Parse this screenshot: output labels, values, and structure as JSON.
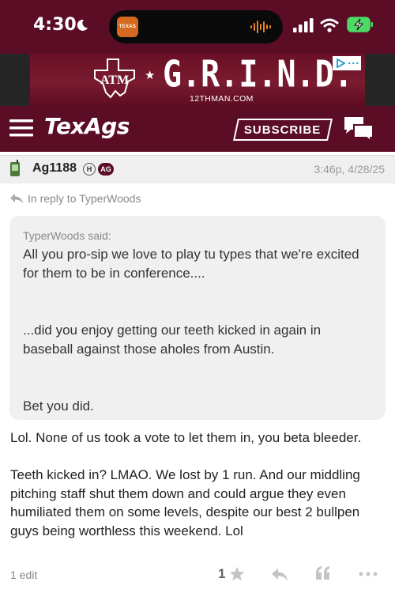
{
  "status_bar": {
    "time": "4:30",
    "island_app_label": "TEXAS"
  },
  "ad": {
    "logo_letters": "ATM",
    "title": "G.R.I.N.D.",
    "subtitle": "12THMAN.COM"
  },
  "nav": {
    "logo": "TexAgs",
    "subscribe_label": "SUBSCRIBE"
  },
  "post": {
    "author": "Ag1188",
    "badge_h": "H",
    "badge_ag": "AG",
    "timestamp": "3:46p, 4/28/25",
    "reply_to": "In reply to TyperWoods",
    "quote_author": "TyperWoods said:",
    "quote_text": "All you pro-sip we love to play tu types that we're excited for them to be in conference....\n\n\n...did you enjoy getting our teeth kicked in again in baseball against those aholes from Austin.\n\n\nBet you did.",
    "body": "Lol. None of us took a vote to let them in, you beta bleeder.\n\nTeeth kicked in? LMAO. We lost by 1 run. And our middling pitching staff shut them down and could argue they even humiliated them on some levels, despite our best 2 bullpen guys being worthless this weekend. Lol",
    "edit_count": "1 edit",
    "star_count": "1"
  },
  "colors": {
    "maroon": "#5c0d26",
    "header_gray": "#efefef",
    "quote_bg": "#f0f0f0"
  }
}
